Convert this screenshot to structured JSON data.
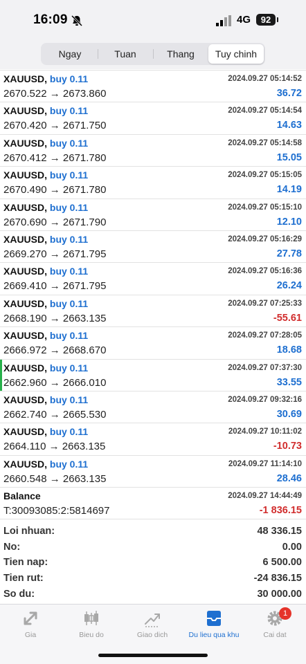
{
  "status_bar": {
    "time": "16:09",
    "network": "4G",
    "battery": "92"
  },
  "tabs": [
    {
      "label": "Ngay",
      "active": false
    },
    {
      "label": "Tuan",
      "active": false
    },
    {
      "label": "Thang",
      "active": false
    },
    {
      "label": "Tuy chinh",
      "active": true
    }
  ],
  "deals": [
    {
      "symbol": "XAUUSD,",
      "side": "buy 0.11",
      "prices": "2670.522 → 2673.860",
      "time": "2024.09.27 05:14:52",
      "profit": "36.72",
      "positive": true
    },
    {
      "symbol": "XAUUSD,",
      "side": "buy 0.11",
      "prices": "2670.420 → 2671.750",
      "time": "2024.09.27 05:14:54",
      "profit": "14.63",
      "positive": true
    },
    {
      "symbol": "XAUUSD,",
      "side": "buy 0.11",
      "prices": "2670.412 → 2671.780",
      "time": "2024.09.27 05:14:58",
      "profit": "15.05",
      "positive": true
    },
    {
      "symbol": "XAUUSD,",
      "side": "buy 0.11",
      "prices": "2670.490 → 2671.780",
      "time": "2024.09.27 05:15:05",
      "profit": "14.19",
      "positive": true
    },
    {
      "symbol": "XAUUSD,",
      "side": "buy 0.11",
      "prices": "2670.690 → 2671.790",
      "time": "2024.09.27 05:15:10",
      "profit": "12.10",
      "positive": true
    },
    {
      "symbol": "XAUUSD,",
      "side": "buy 0.11",
      "prices": "2669.270 → 2671.795",
      "time": "2024.09.27 05:16:29",
      "profit": "27.78",
      "positive": true
    },
    {
      "symbol": "XAUUSD,",
      "side": "buy 0.11",
      "prices": "2669.410 → 2671.795",
      "time": "2024.09.27 05:16:36",
      "profit": "26.24",
      "positive": true
    },
    {
      "symbol": "XAUUSD,",
      "side": "buy 0.11",
      "prices": "2668.190 → 2663.135",
      "time": "2024.09.27 07:25:33",
      "profit": "-55.61",
      "positive": false
    },
    {
      "symbol": "XAUUSD,",
      "side": "buy 0.11",
      "prices": "2666.972 → 2668.670",
      "time": "2024.09.27 07:28:05",
      "profit": "18.68",
      "positive": true
    },
    {
      "symbol": "XAUUSD,",
      "side": "buy 0.11",
      "prices": "2662.960 → 2666.010",
      "time": "2024.09.27 07:37:30",
      "profit": "33.55",
      "positive": true
    },
    {
      "symbol": "XAUUSD,",
      "side": "buy 0.11",
      "prices": "2662.740 → 2665.530",
      "time": "2024.09.27 09:32:16",
      "profit": "30.69",
      "positive": true
    },
    {
      "symbol": "XAUUSD,",
      "side": "buy 0.11",
      "prices": "2664.110 → 2663.135",
      "time": "2024.09.27 10:11:02",
      "profit": "-10.73",
      "positive": false
    },
    {
      "symbol": "XAUUSD,",
      "side": "buy 0.11",
      "prices": "2660.548 → 2663.135",
      "time": "2024.09.27 11:14:10",
      "profit": "28.46",
      "positive": true
    },
    {
      "symbol": "Balance",
      "side": "",
      "prices": "T:30093085:2:5814697",
      "time": "2024.09.27 14:44:49",
      "profit": "-1 836.15",
      "positive": false
    }
  ],
  "summary": [
    {
      "label": "Loi nhuan:",
      "value": "48 336.15"
    },
    {
      "label": "No:",
      "value": "0.00"
    },
    {
      "label": "Tien nap:",
      "value": "6 500.00"
    },
    {
      "label": "Tien rut:",
      "value": "-24 836.15"
    },
    {
      "label": "So du:",
      "value": "30 000.00"
    }
  ],
  "nav": [
    {
      "label": "Gia",
      "icon": "quotes-icon",
      "active": false
    },
    {
      "label": "Bieu do",
      "icon": "chart-icon",
      "active": false
    },
    {
      "label": "Giao dich",
      "icon": "trade-icon",
      "active": false
    },
    {
      "label": "Du lieu qua khu",
      "icon": "history-icon",
      "active": true
    },
    {
      "label": "Cai dat",
      "icon": "settings-icon",
      "active": false,
      "badge": "1"
    }
  ],
  "colors": {
    "positive": "#1e6fd0",
    "negative": "#d12d2d",
    "active_tab": "#1e6fd0",
    "marker": "#27b04a"
  }
}
